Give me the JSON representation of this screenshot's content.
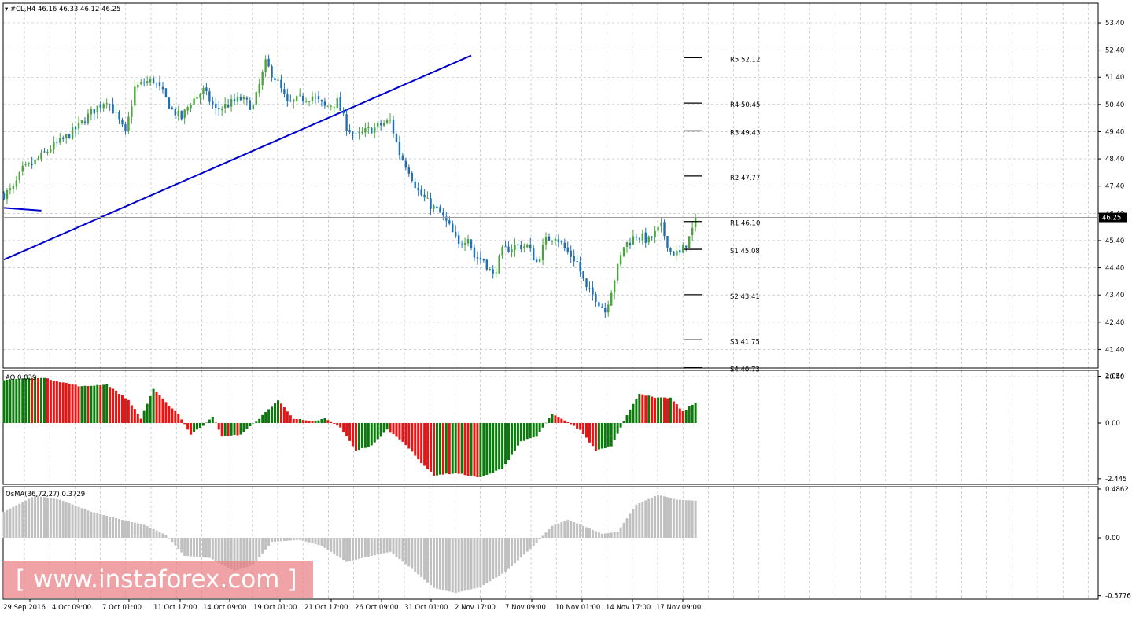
{
  "chart_data": {
    "type": "candlestick",
    "header": {
      "title": "#CL,H4",
      "ohlc": "46.16 46.33 46.12 46.25"
    },
    "colors": {
      "bull": "#4aa33e",
      "bear": "#1e6fb5",
      "trendline": "#0000cc",
      "ao_up": "#0a7a0a",
      "ao_down": "#ee1111",
      "osma": "#c0c0c0",
      "grid": "#a9b4bf",
      "frame": "#000000"
    },
    "main": {
      "y_axis": {
        "min": 40.4,
        "max": 53.4,
        "ticks": [
          "53.40",
          "52.40",
          "51.40",
          "50.40",
          "49.40",
          "48.40",
          "47.40",
          "46.40",
          "45.40",
          "44.40",
          "43.40",
          "42.40",
          "41.40",
          "40.40"
        ]
      },
      "current_price": "46.25",
      "pivots": [
        {
          "label": "R5 52.12",
          "value": 52.12
        },
        {
          "label": "R4 50.45",
          "value": 50.45
        },
        {
          "label": "R3 49.43",
          "value": 49.43
        },
        {
          "label": "R2 47.77",
          "value": 47.77
        },
        {
          "label": "R1 46.10",
          "value": 46.1
        },
        {
          "label": "S1 45.08",
          "value": 45.08
        },
        {
          "label": "S2 43.41",
          "value": 43.41
        },
        {
          "label": "S3 41.75",
          "value": 41.75
        },
        {
          "label": "S4 40.73",
          "value": 40.73
        }
      ],
      "trendline": {
        "from_bar": 0,
        "from_price": 44.7,
        "to_bar": 150,
        "to_price": 52.2
      },
      "short_line": {
        "from_bar": 0,
        "from_price": 46.6,
        "to_bar": 12,
        "to_price": 46.5
      },
      "close_path": [
        [
          0,
          47.1
        ],
        [
          3,
          47.3
        ],
        [
          6,
          48.0
        ],
        [
          9,
          48.2
        ],
        [
          12,
          48.5
        ],
        [
          15,
          48.8
        ],
        [
          19,
          49.1
        ],
        [
          24,
          49.6
        ],
        [
          28,
          50.1
        ],
        [
          33,
          50.6
        ],
        [
          36,
          50.0
        ],
        [
          39,
          49.3
        ],
        [
          42,
          51.0
        ],
        [
          45,
          51.2
        ],
        [
          48,
          51.3
        ],
        [
          51,
          50.8
        ],
        [
          54,
          50.2
        ],
        [
          57,
          49.9
        ],
        [
          60,
          50.5
        ],
        [
          64,
          50.9
        ],
        [
          68,
          50.2
        ],
        [
          72,
          50.4
        ],
        [
          76,
          50.6
        ],
        [
          80,
          50.3
        ],
        [
          84,
          51.9
        ],
        [
          88,
          51.2
        ],
        [
          91,
          50.4
        ],
        [
          95,
          50.6
        ],
        [
          99,
          50.7
        ],
        [
          103,
          50.3
        ],
        [
          107,
          50.5
        ],
        [
          110,
          49.6
        ],
        [
          113,
          49.2
        ],
        [
          116,
          49.4
        ],
        [
          120,
          49.6
        ],
        [
          124,
          49.8
        ],
        [
          127,
          48.6
        ],
        [
          130,
          48.0
        ],
        [
          133,
          47.2
        ],
        [
          136,
          46.8
        ],
        [
          140,
          46.4
        ],
        [
          143,
          45.9
        ],
        [
          146,
          45.2
        ],
        [
          149,
          45.6
        ],
        [
          151,
          44.8
        ],
        [
          154,
          44.7
        ],
        [
          157,
          44.1
        ],
        [
          160,
          45.0
        ],
        [
          164,
          45.2
        ],
        [
          168,
          45.2
        ],
        [
          171,
          44.6
        ],
        [
          174,
          45.4
        ],
        [
          177,
          45.6
        ],
        [
          180,
          45.1
        ],
        [
          184,
          44.6
        ],
        [
          187,
          43.6
        ],
        [
          190,
          43.3
        ],
        [
          193,
          42.8
        ],
        [
          196,
          44.0
        ],
        [
          199,
          45.2
        ],
        [
          203,
          45.6
        ],
        [
          207,
          45.4
        ],
        [
          211,
          45.9
        ],
        [
          214,
          45.0
        ],
        [
          217,
          44.9
        ],
        [
          220,
          45.5
        ],
        [
          222,
          46.1
        ]
      ],
      "bars": 222,
      "x_axis_labels": [
        "29 Sep 2016",
        "4 Oct 09:00",
        "7 Oct 01:00",
        "11 Oct 17:00",
        "14 Oct 09:00",
        "19 Oct 01:00",
        "21 Oct 17:00",
        "26 Oct 09:00",
        "31 Oct 01:00",
        "2 Nov 17:00",
        "7 Nov 09:00",
        "10 Nov 01:00",
        "14 Nov 17:00",
        "17 Nov 09:00"
      ]
    },
    "ao": {
      "title": "AO 0.839",
      "y_axis": {
        "min": -2.445,
        "max": 2.054,
        "ticks": [
          "2.054",
          "0.00",
          "-2.445"
        ]
      },
      "path": [
        [
          0,
          1.9
        ],
        [
          12,
          2.0
        ],
        [
          25,
          1.6
        ],
        [
          33,
          1.7
        ],
        [
          40,
          1.0
        ],
        [
          44,
          0.2
        ],
        [
          48,
          1.5
        ],
        [
          52,
          0.9
        ],
        [
          56,
          0.4
        ],
        [
          60,
          -0.5
        ],
        [
          64,
          -0.1
        ],
        [
          67,
          0.3
        ],
        [
          70,
          -0.6
        ],
        [
          76,
          -0.5
        ],
        [
          82,
          0.2
        ],
        [
          88,
          1.0
        ],
        [
          93,
          0.2
        ],
        [
          99,
          0.05
        ],
        [
          103,
          0.2
        ],
        [
          108,
          -0.2
        ],
        [
          113,
          -1.2
        ],
        [
          118,
          -1.0
        ],
        [
          123,
          -0.3
        ],
        [
          128,
          -0.8
        ],
        [
          133,
          -1.6
        ],
        [
          138,
          -2.3
        ],
        [
          145,
          -2.2
        ],
        [
          153,
          -2.4
        ],
        [
          160,
          -2.0
        ],
        [
          166,
          -0.8
        ],
        [
          171,
          -0.6
        ],
        [
          176,
          0.4
        ],
        [
          180,
          0.1
        ],
        [
          185,
          -0.3
        ],
        [
          190,
          -1.2
        ],
        [
          195,
          -1.0
        ],
        [
          199,
          0.1
        ],
        [
          204,
          1.3
        ],
        [
          209,
          1.1
        ],
        [
          214,
          1.1
        ],
        [
          218,
          0.5
        ],
        [
          222,
          0.9
        ]
      ]
    },
    "osma": {
      "title": "OsMA(36,72,27) 0.3729",
      "y_axis": {
        "min": -0.5776,
        "max": 0.4862,
        "ticks": [
          "0.4862",
          "0.00",
          "-0.5776"
        ]
      },
      "path": [
        [
          0,
          0.26
        ],
        [
          10,
          0.42
        ],
        [
          18,
          0.38
        ],
        [
          28,
          0.26
        ],
        [
          38,
          0.18
        ],
        [
          45,
          0.13
        ],
        [
          52,
          0.03
        ],
        [
          58,
          -0.18
        ],
        [
          66,
          -0.2
        ],
        [
          74,
          -0.33
        ],
        [
          80,
          -0.27
        ],
        [
          86,
          -0.04
        ],
        [
          95,
          -0.02
        ],
        [
          102,
          -0.08
        ],
        [
          110,
          -0.24
        ],
        [
          118,
          -0.18
        ],
        [
          124,
          -0.14
        ],
        [
          131,
          -0.31
        ],
        [
          138,
          -0.5
        ],
        [
          145,
          -0.55
        ],
        [
          153,
          -0.49
        ],
        [
          161,
          -0.34
        ],
        [
          170,
          -0.08
        ],
        [
          176,
          0.12
        ],
        [
          181,
          0.18
        ],
        [
          186,
          0.12
        ],
        [
          192,
          0.04
        ],
        [
          197,
          0.06
        ],
        [
          203,
          0.33
        ],
        [
          210,
          0.43
        ],
        [
          216,
          0.38
        ],
        [
          222,
          0.37
        ]
      ]
    }
  },
  "watermark": {
    "text": "[ www.instaforex.com ]"
  }
}
